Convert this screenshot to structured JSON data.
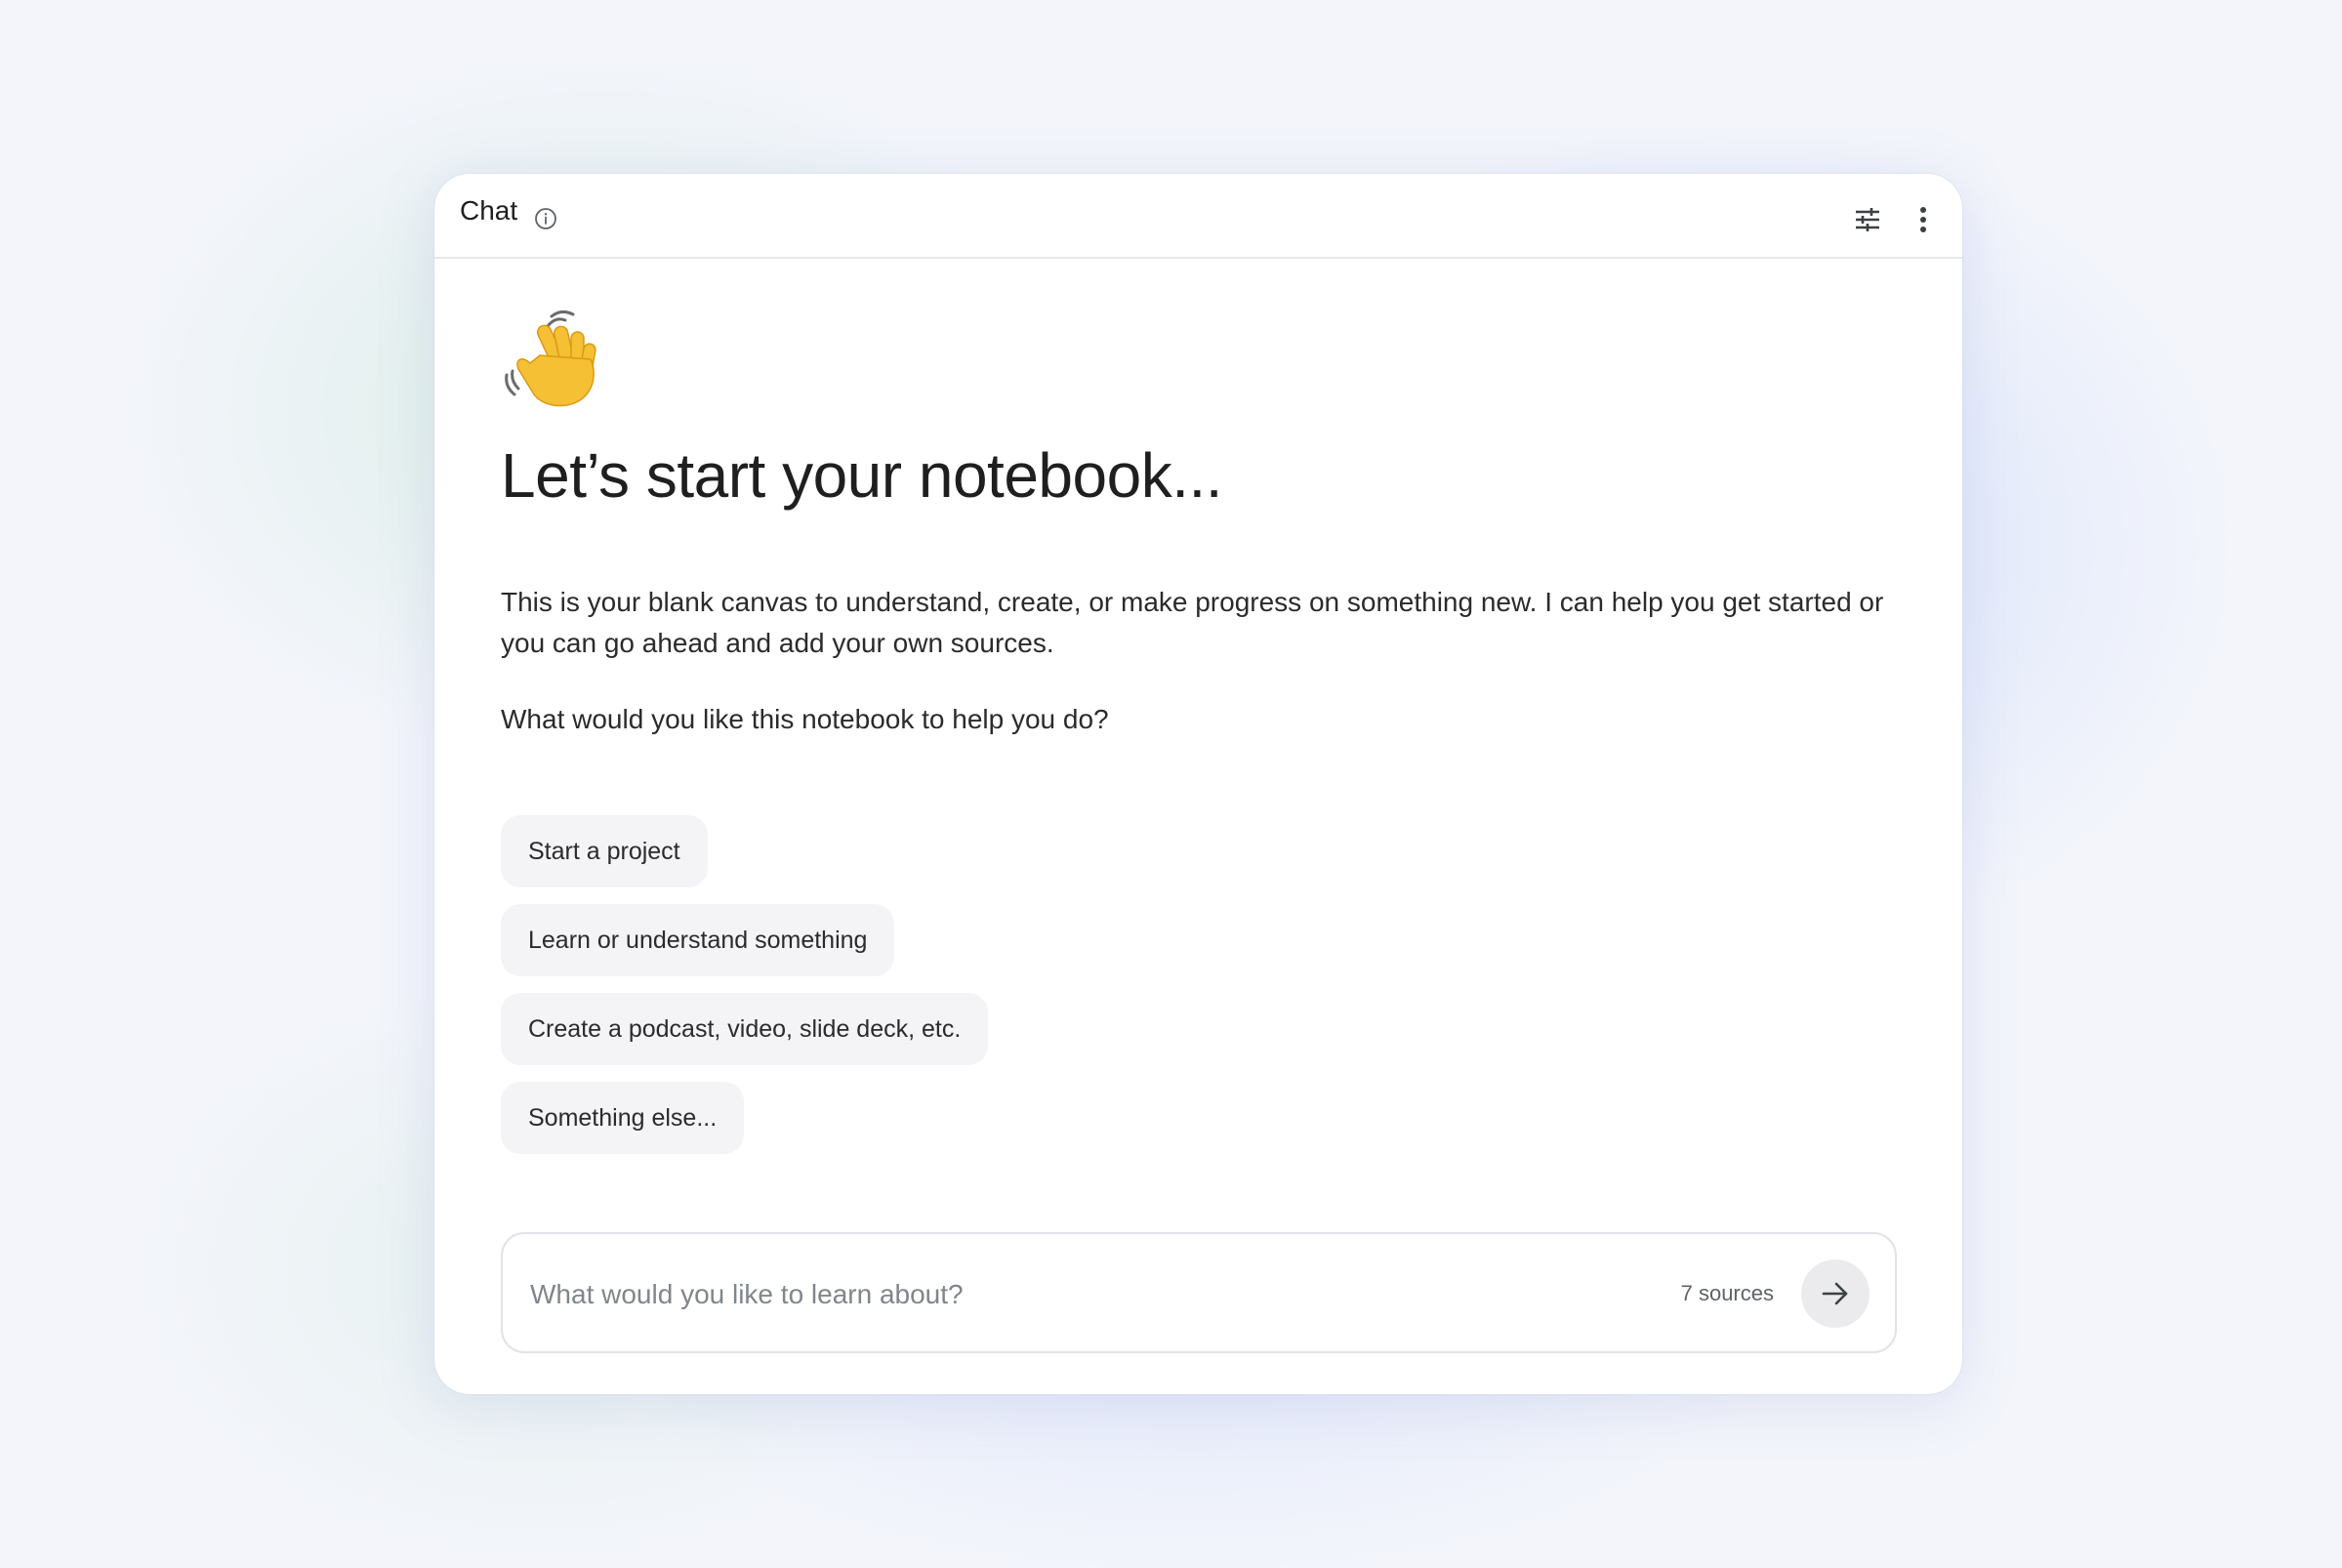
{
  "header": {
    "title": "Chat",
    "info_icon": "info-icon",
    "tune_icon": "tune-icon",
    "more_icon": "more-vertical-icon"
  },
  "welcome": {
    "emoji": "waving-hand-emoji",
    "headline": "Let’s start your notebook...",
    "intro": "This is your blank canvas to understand, create, or make progress on something new. I can help you get started or you can go ahead and add your own sources.",
    "question": "What would you like this notebook to help you do?"
  },
  "suggestions": [
    {
      "label": "Start a project"
    },
    {
      "label": "Learn or understand something"
    },
    {
      "label": "Create a podcast, video, slide deck, etc."
    },
    {
      "label": "Something else..."
    }
  ],
  "composer": {
    "placeholder": "What would you like to learn about?",
    "value": "",
    "sources_label": "7 sources",
    "send_icon": "arrow-right-icon"
  },
  "colors": {
    "text_primary": "#1f1f1f",
    "text_secondary": "#5f6368",
    "chip_bg": "#f4f4f6",
    "card_bg": "#ffffff",
    "emoji_yellow": "#f5c033"
  }
}
